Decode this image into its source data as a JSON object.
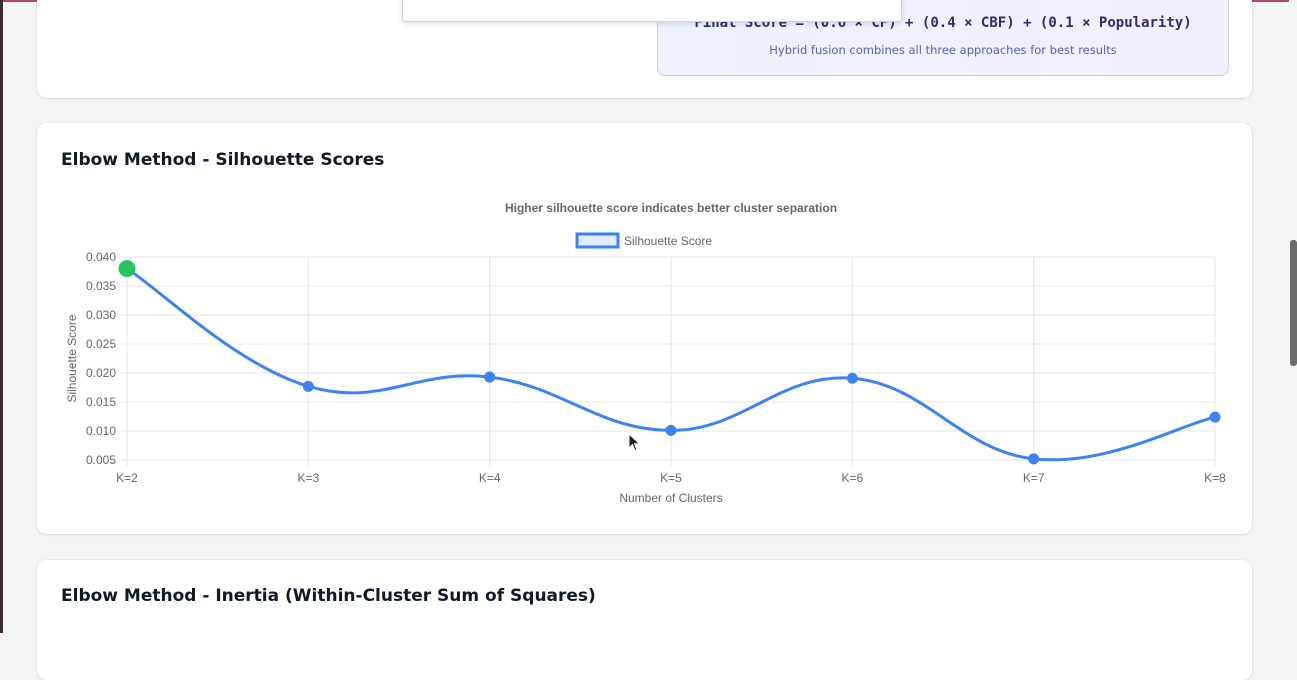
{
  "formula": {
    "text": "Final Score = (0.6 × CF) + (0.4 × CBF) + (0.1 × Popularity)",
    "subtitle": "Hybrid fusion combines all three approaches for best results"
  },
  "silhouette_card": {
    "title": "Elbow Method - Silhouette Scores"
  },
  "inertia_card": {
    "title": "Elbow Method - Inertia (Within-Cluster Sum of Squares)"
  },
  "colors": {
    "line": "#3b82f6",
    "highlight": "#22c55e",
    "grid": "#e5e5e5",
    "text": "#666666"
  },
  "chart_data": {
    "type": "line",
    "title": "Higher silhouette score indicates better cluster separation",
    "xlabel": "Number of Clusters",
    "ylabel": "Silhouette Score",
    "categories": [
      "K=2",
      "K=3",
      "K=4",
      "K=5",
      "K=6",
      "K=7",
      "K=8"
    ],
    "series": [
      {
        "name": "Silhouette Score",
        "values": [
          0.038,
          0.0177,
          0.0193,
          0.0101,
          0.0191,
          0.0052,
          0.0124
        ],
        "highlight_index": 0
      }
    ],
    "ylim": [
      0.005,
      0.04
    ],
    "yticks": [
      0.04,
      0.035,
      0.03,
      0.025,
      0.02,
      0.015,
      0.01,
      0.005
    ],
    "grid": true,
    "legend": "top-center"
  }
}
